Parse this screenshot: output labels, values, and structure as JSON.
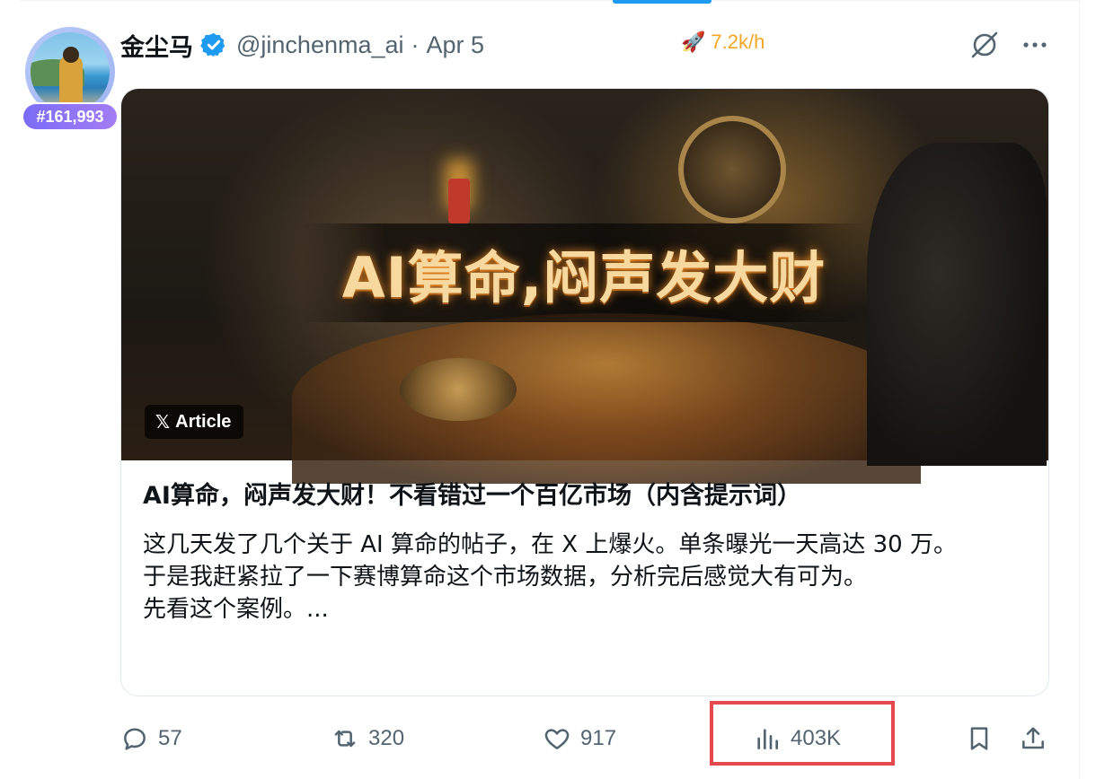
{
  "author": {
    "display_name": "金尘马",
    "handle": "@jinchenma_ai",
    "separator": "·",
    "date": "Apr 5",
    "rank_badge": "#161,993",
    "verified": true
  },
  "stats_rate": {
    "icon": "rocket-icon",
    "value": "7.2k/h",
    "color": "#f5a623"
  },
  "header_icons": [
    "grok-icon",
    "more-icon"
  ],
  "article": {
    "badge_label": "Article",
    "image_banner_text": "AI算命,闷声发大财",
    "title": "AI算命，闷声发大财！不看错过一个百亿市场（内含提示词）",
    "preview_lines": [
      "这几天发了几个关于 AI 算命的帖子，在 X 上爆火。单条曝光一天高达 30 万。",
      "于是我赶紧拉了一下赛博算命这个市场数据，分析完后感觉大有可为。",
      "先看这个案例。..."
    ]
  },
  "actions": {
    "replies": "57",
    "reposts": "320",
    "likes": "917",
    "views": "403K"
  },
  "colors": {
    "accent": "#1d9bf0",
    "muted": "#536471",
    "highlight": "#e5484d",
    "badge": "#7b6cf6"
  }
}
